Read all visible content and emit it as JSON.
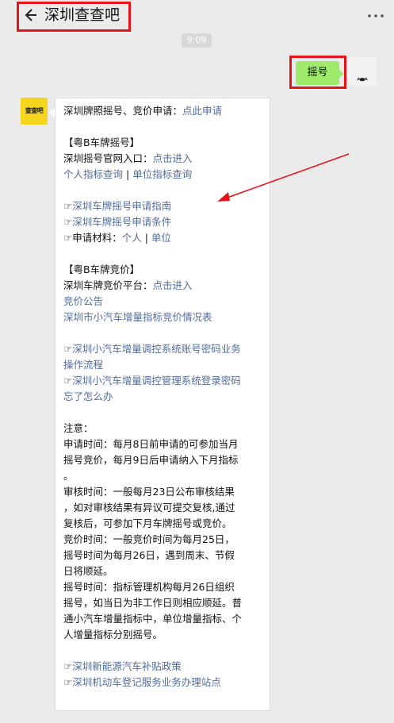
{
  "header": {
    "title": "深圳查查吧"
  },
  "time": "9:09",
  "outgoing": {
    "text": "摇号"
  },
  "bot": {
    "avatar_text": "查查吧"
  },
  "message": {
    "l1_prefix": "深圳牌照摇号、竞价申请：",
    "l1_link": "点此申请",
    "s1_title": "【粤B车牌摇号】",
    "s1_l1_prefix": "深圳摇号官网入口：",
    "s1_l1_link": "点击进入",
    "s1_l2_link1": "个人指标查询",
    "s1_l2_sep": " | ",
    "s1_l2_link2": "单位指标查询",
    "g1_link": "深圳车牌摇号申请指南",
    "g2_link": "深圳车牌摇号申请条件",
    "g3_prefix": "申请材料：",
    "g3_link1": "个人",
    "g3_sep": " | ",
    "g3_link2": "单位",
    "s2_title": "【粤B车牌竞价】",
    "s2_l1_prefix": "深圳车牌竞价平台：",
    "s2_l1_link": "点击进入",
    "s2_l2_link": "竞价公告",
    "s2_l3_link": "深圳市小汽车增量指标竞价情况表",
    "g4_link_a": "深圳小汽车增量调控系统账号密码业务",
    "g4_link_b": "操作流程",
    "g5_link_a": "深圳小汽车增量调控管理系统登录密码",
    "g5_link_b": "忘了怎么办",
    "note_title": "注意：",
    "n1_a": "申请时间：每月8日前申请的可参加当月",
    "n1_b": "摇号竞价，每月9日后申请纳入下月指标",
    "n1_c": "。",
    "n2_a": "审核时间：一般每月23日公布审核结果",
    "n2_b": "，如对审核结果有异议可提交复核,通过",
    "n2_c": "复核后，可参加下月车牌摇号或竞价。",
    "n3_a": "竞价时间：一般竞价时间为每月25日，",
    "n3_b": "摇号时间为每月26日，遇到周末、节假",
    "n3_c": "日将顺延。",
    "n4_a": "摇号时间：指标管理机构每月26日组织",
    "n4_b": "摇号，如当日为非工作日则相应顺延。普",
    "n4_c": "通小汽车增量指标中，单位增量指标、个",
    "n4_d": "人增量指标分别摇号。",
    "g6_link": "深圳新能源汽车补贴政策",
    "g7_link": "深圳机动车登记服务业务办理站点"
  },
  "colors": {
    "link": "#526b9a",
    "highlight_box": "#e5141a",
    "bubble_out": "#9eea6a",
    "background": "#ebebeb"
  }
}
